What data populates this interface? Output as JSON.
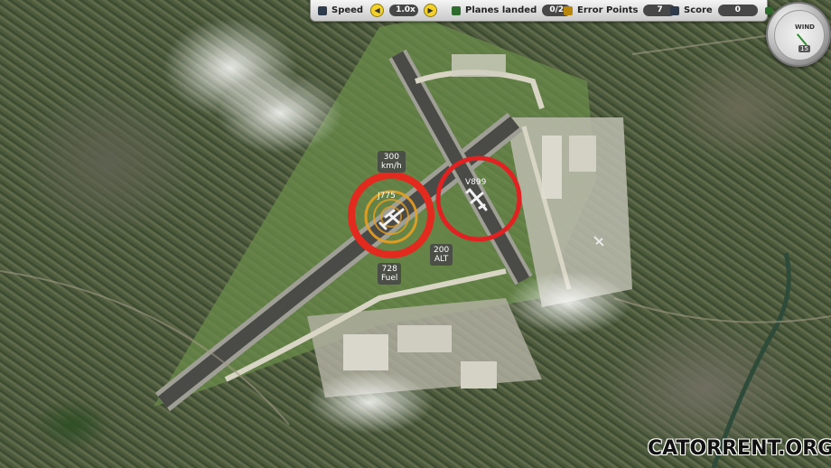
{
  "hud": {
    "speed_label": "Speed",
    "speed_value": "1.0x",
    "planes_label": "Planes landed",
    "planes_value": "0/2",
    "errors_label": "Error Points",
    "errors_value": "7",
    "score_label": "Score",
    "score_value": "0"
  },
  "wind": {
    "label": "WIND",
    "value": "15"
  },
  "planes": [
    {
      "callsign": "J775",
      "speed": "300\nkm/h",
      "fuel": "728\nFuel",
      "status": "selected"
    },
    {
      "callsign": "V899",
      "altitude": "200\nALT",
      "status": "warning"
    }
  ],
  "watermark": "CATORRENT.ORG",
  "colors": {
    "accent": "#f3d12a",
    "ring": "#e02222",
    "hud_field": "#474747"
  }
}
